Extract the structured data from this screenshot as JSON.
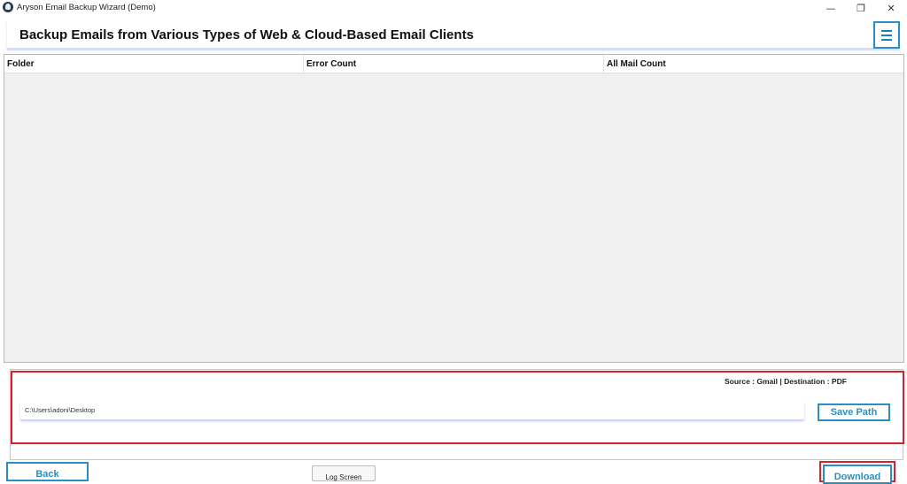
{
  "window": {
    "title": "Aryson Email Backup Wizard (Demo)",
    "minimize_glyph": "—",
    "restore_glyph": "❐",
    "close_glyph": "✕"
  },
  "header": {
    "title": "Backup Emails from Various Types of Web & Cloud-Based Email Clients",
    "menu_icon": "hamburger-menu-icon"
  },
  "table": {
    "columns": [
      "Folder",
      "Error Count",
      "All Mail Count"
    ],
    "rows": []
  },
  "summary": {
    "source_destination": "Source : Gmail | Destination : PDF"
  },
  "path": {
    "value": "C:\\Users\\adoni\\Desktop"
  },
  "buttons": {
    "save_path": "Save Path",
    "back": "Back",
    "log_screen": "Log Screen",
    "download": "Download"
  },
  "colors": {
    "accent": "#2a8fc4",
    "highlight": "#d8222b",
    "grid_background": "#f0f0f0"
  }
}
